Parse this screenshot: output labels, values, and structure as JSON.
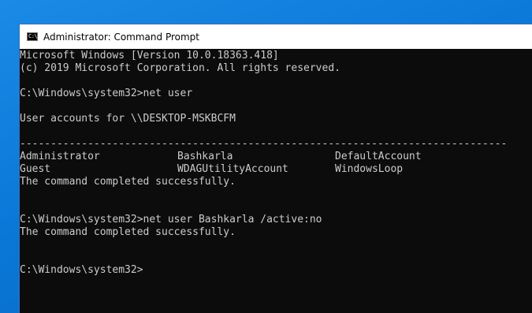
{
  "window": {
    "title": "Administrator: Command Prompt",
    "icon": "cmd-icon",
    "icon_glyph": "C:\\"
  },
  "console": {
    "line1": "Microsoft Windows [Version 10.0.18363.418]",
    "line2": "(c) 2019 Microsoft Corporation. All rights reserved.",
    "prompt1": "C:\\Windows\\system32>net user",
    "accounts_header": "User accounts for \\\\DESKTOP-MSKBCFM",
    "separator": "-------------------------------------------------------------------------------",
    "accounts": [
      [
        "Administrator",
        "Bashkarla",
        "DefaultAccount"
      ],
      [
        "Guest",
        "WDAGUtilityAccount",
        "WindowsLoop"
      ]
    ],
    "completed1": "The command completed successfully.",
    "prompt2": "C:\\Windows\\system32>net user Bashkarla /active:no",
    "completed2": "The command completed successfully.",
    "prompt3": "C:\\Windows\\system32>"
  },
  "colors": {
    "console_bg": "#0c0c0c",
    "console_text": "#cccccc",
    "desktop": "#0a78d7"
  }
}
